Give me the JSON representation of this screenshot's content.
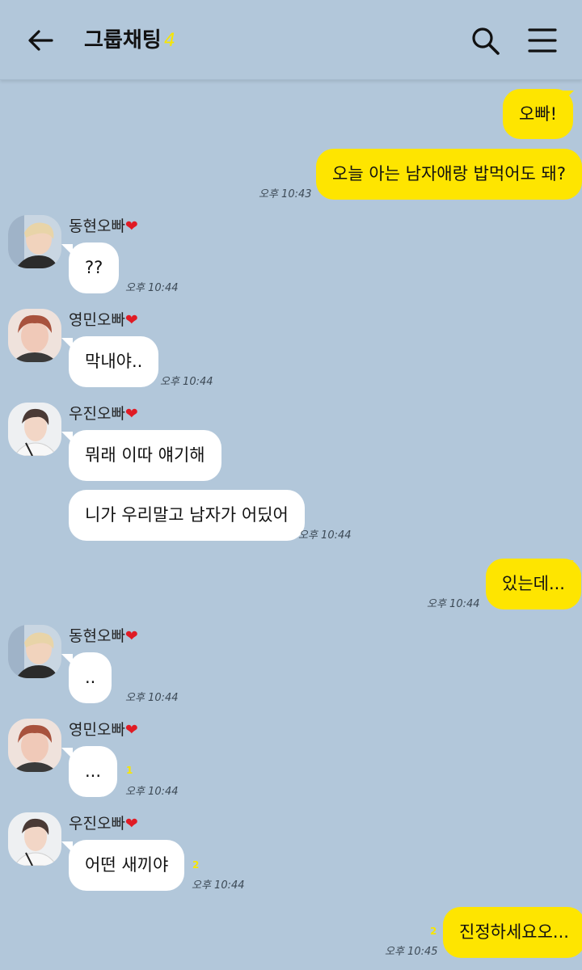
{
  "header": {
    "title": "그룹채팅",
    "member_count": "4"
  },
  "messages": {
    "m1": {
      "text": "오빠!"
    },
    "m2": {
      "text": "오늘 아는 남자애랑 밥먹어도 돼?",
      "time": "오후 10:43"
    },
    "g1": {
      "name": "동현오빠",
      "heart": "❤"
    },
    "m3": {
      "text": "??",
      "time": "오후 10:44"
    },
    "g2": {
      "name": "영민오빠",
      "heart": "❤"
    },
    "m4": {
      "text": "막내야..",
      "time": "오후 10:44"
    },
    "g3": {
      "name": "우진오빠",
      "heart": "❤"
    },
    "m5": {
      "text": "뭐래 이따 얘기해"
    },
    "m6": {
      "text": "니가 우리말고 남자가 어딨어",
      "time": "오후 10:44"
    },
    "m7": {
      "text": "있는데...",
      "time": "오후 10:44"
    },
    "g4": {
      "name": "동현오빠",
      "heart": "❤"
    },
    "m8": {
      "text": "..",
      "time": "오후 10:44"
    },
    "g5": {
      "name": "영민오빠",
      "heart": "❤"
    },
    "m9": {
      "text": "...",
      "time": "오후 10:44",
      "unread": "1"
    },
    "g6": {
      "name": "우진오빠",
      "heart": "❤"
    },
    "m10": {
      "text": "어떤 새끼야",
      "time": "오후 10:44",
      "unread": "2"
    },
    "m11": {
      "text": "진정하세요오...",
      "time": "오후 10:45",
      "unread": "2"
    }
  },
  "colors": {
    "background": "#b2c7da",
    "my_bubble": "#fee500",
    "other_bubble": "#ffffff",
    "heart": "#e01b24",
    "unread": "#f7e600"
  },
  "icons": [
    "back-arrow-icon",
    "search-icon",
    "menu-icon"
  ]
}
